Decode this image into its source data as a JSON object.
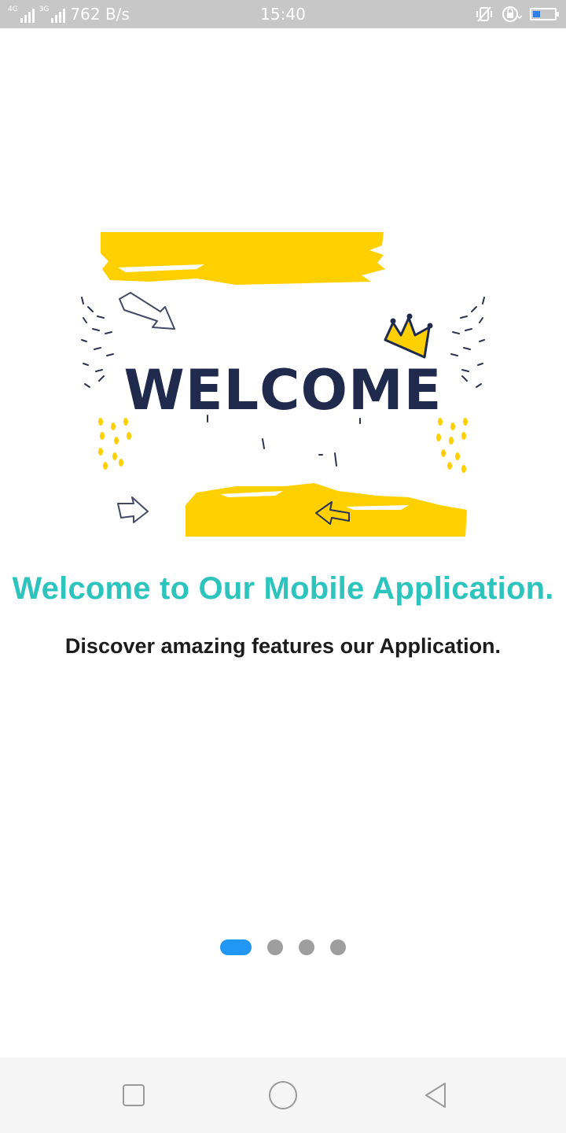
{
  "status_bar": {
    "network_4g": "4G",
    "network_3g": "3G",
    "speed": "762 B/s",
    "time": "15:40",
    "battery_level": 0.35,
    "icons": [
      "signal-icon",
      "vibrate-icon",
      "rotation-lock-icon",
      "battery-icon"
    ]
  },
  "illustration": {
    "text": "WELCOME",
    "colors": {
      "yellow": "#ffd000",
      "navy": "#1f2a4d"
    }
  },
  "onboarding": {
    "title": "Welcome to Our Mobile Application.",
    "subtitle": "Discover amazing features our Application.",
    "page_count": 4,
    "current_page": 1
  },
  "colors": {
    "title": "#2ec4be",
    "active_dot": "#2196f3",
    "inactive_dot": "#9e9e9e"
  },
  "nav_bar": {
    "icons": [
      "recent-apps-icon",
      "home-icon",
      "back-icon"
    ]
  }
}
